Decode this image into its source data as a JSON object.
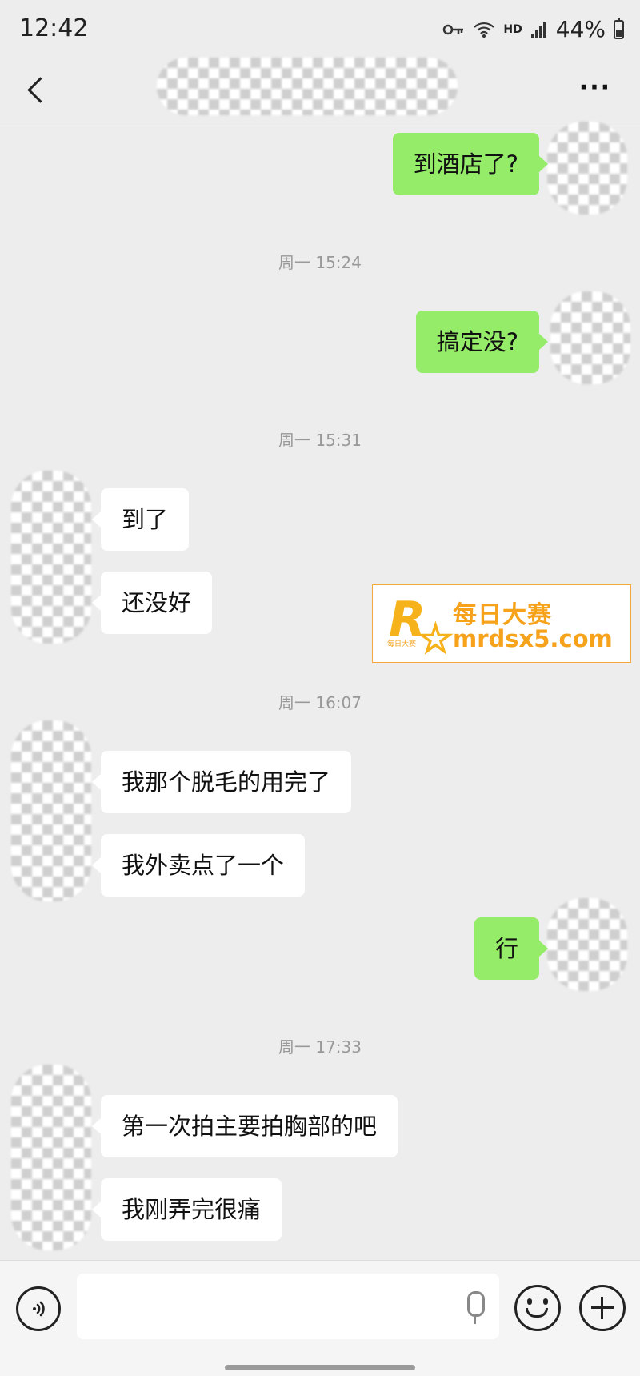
{
  "status_bar": {
    "time": "12:42",
    "hd": "HD",
    "battery": "44%"
  },
  "header": {
    "more": "···"
  },
  "messages": [
    {
      "type": "out",
      "text": "到酒店了?"
    },
    {
      "type": "time",
      "text": "周一 15:24"
    },
    {
      "type": "out",
      "text": "搞定没?"
    },
    {
      "type": "time",
      "text": "周一 15:31"
    },
    {
      "type": "in",
      "text": "到了"
    },
    {
      "type": "in",
      "text": "还没好"
    },
    {
      "type": "time",
      "text": "周一 16:07"
    },
    {
      "type": "in",
      "text": "我那个脱毛的用完了"
    },
    {
      "type": "in",
      "text": "我外卖点了一个"
    },
    {
      "type": "out",
      "text": "行"
    },
    {
      "type": "time",
      "text": "周一 17:33"
    },
    {
      "type": "in",
      "text": "第一次拍主要拍胸部的吧"
    },
    {
      "type": "in",
      "text": "我刚弄完很痛"
    }
  ],
  "watermark": {
    "logo_letter": "R",
    "logo_small": "每日大赛",
    "cn": "每日大赛",
    "url": "mrdsx5.com",
    "color": "#f6a21b"
  },
  "input_bar": {
    "placeholder": ""
  },
  "colors": {
    "out_bubble": "#95ec69",
    "in_bubble": "#ffffff",
    "background": "#ededed"
  }
}
